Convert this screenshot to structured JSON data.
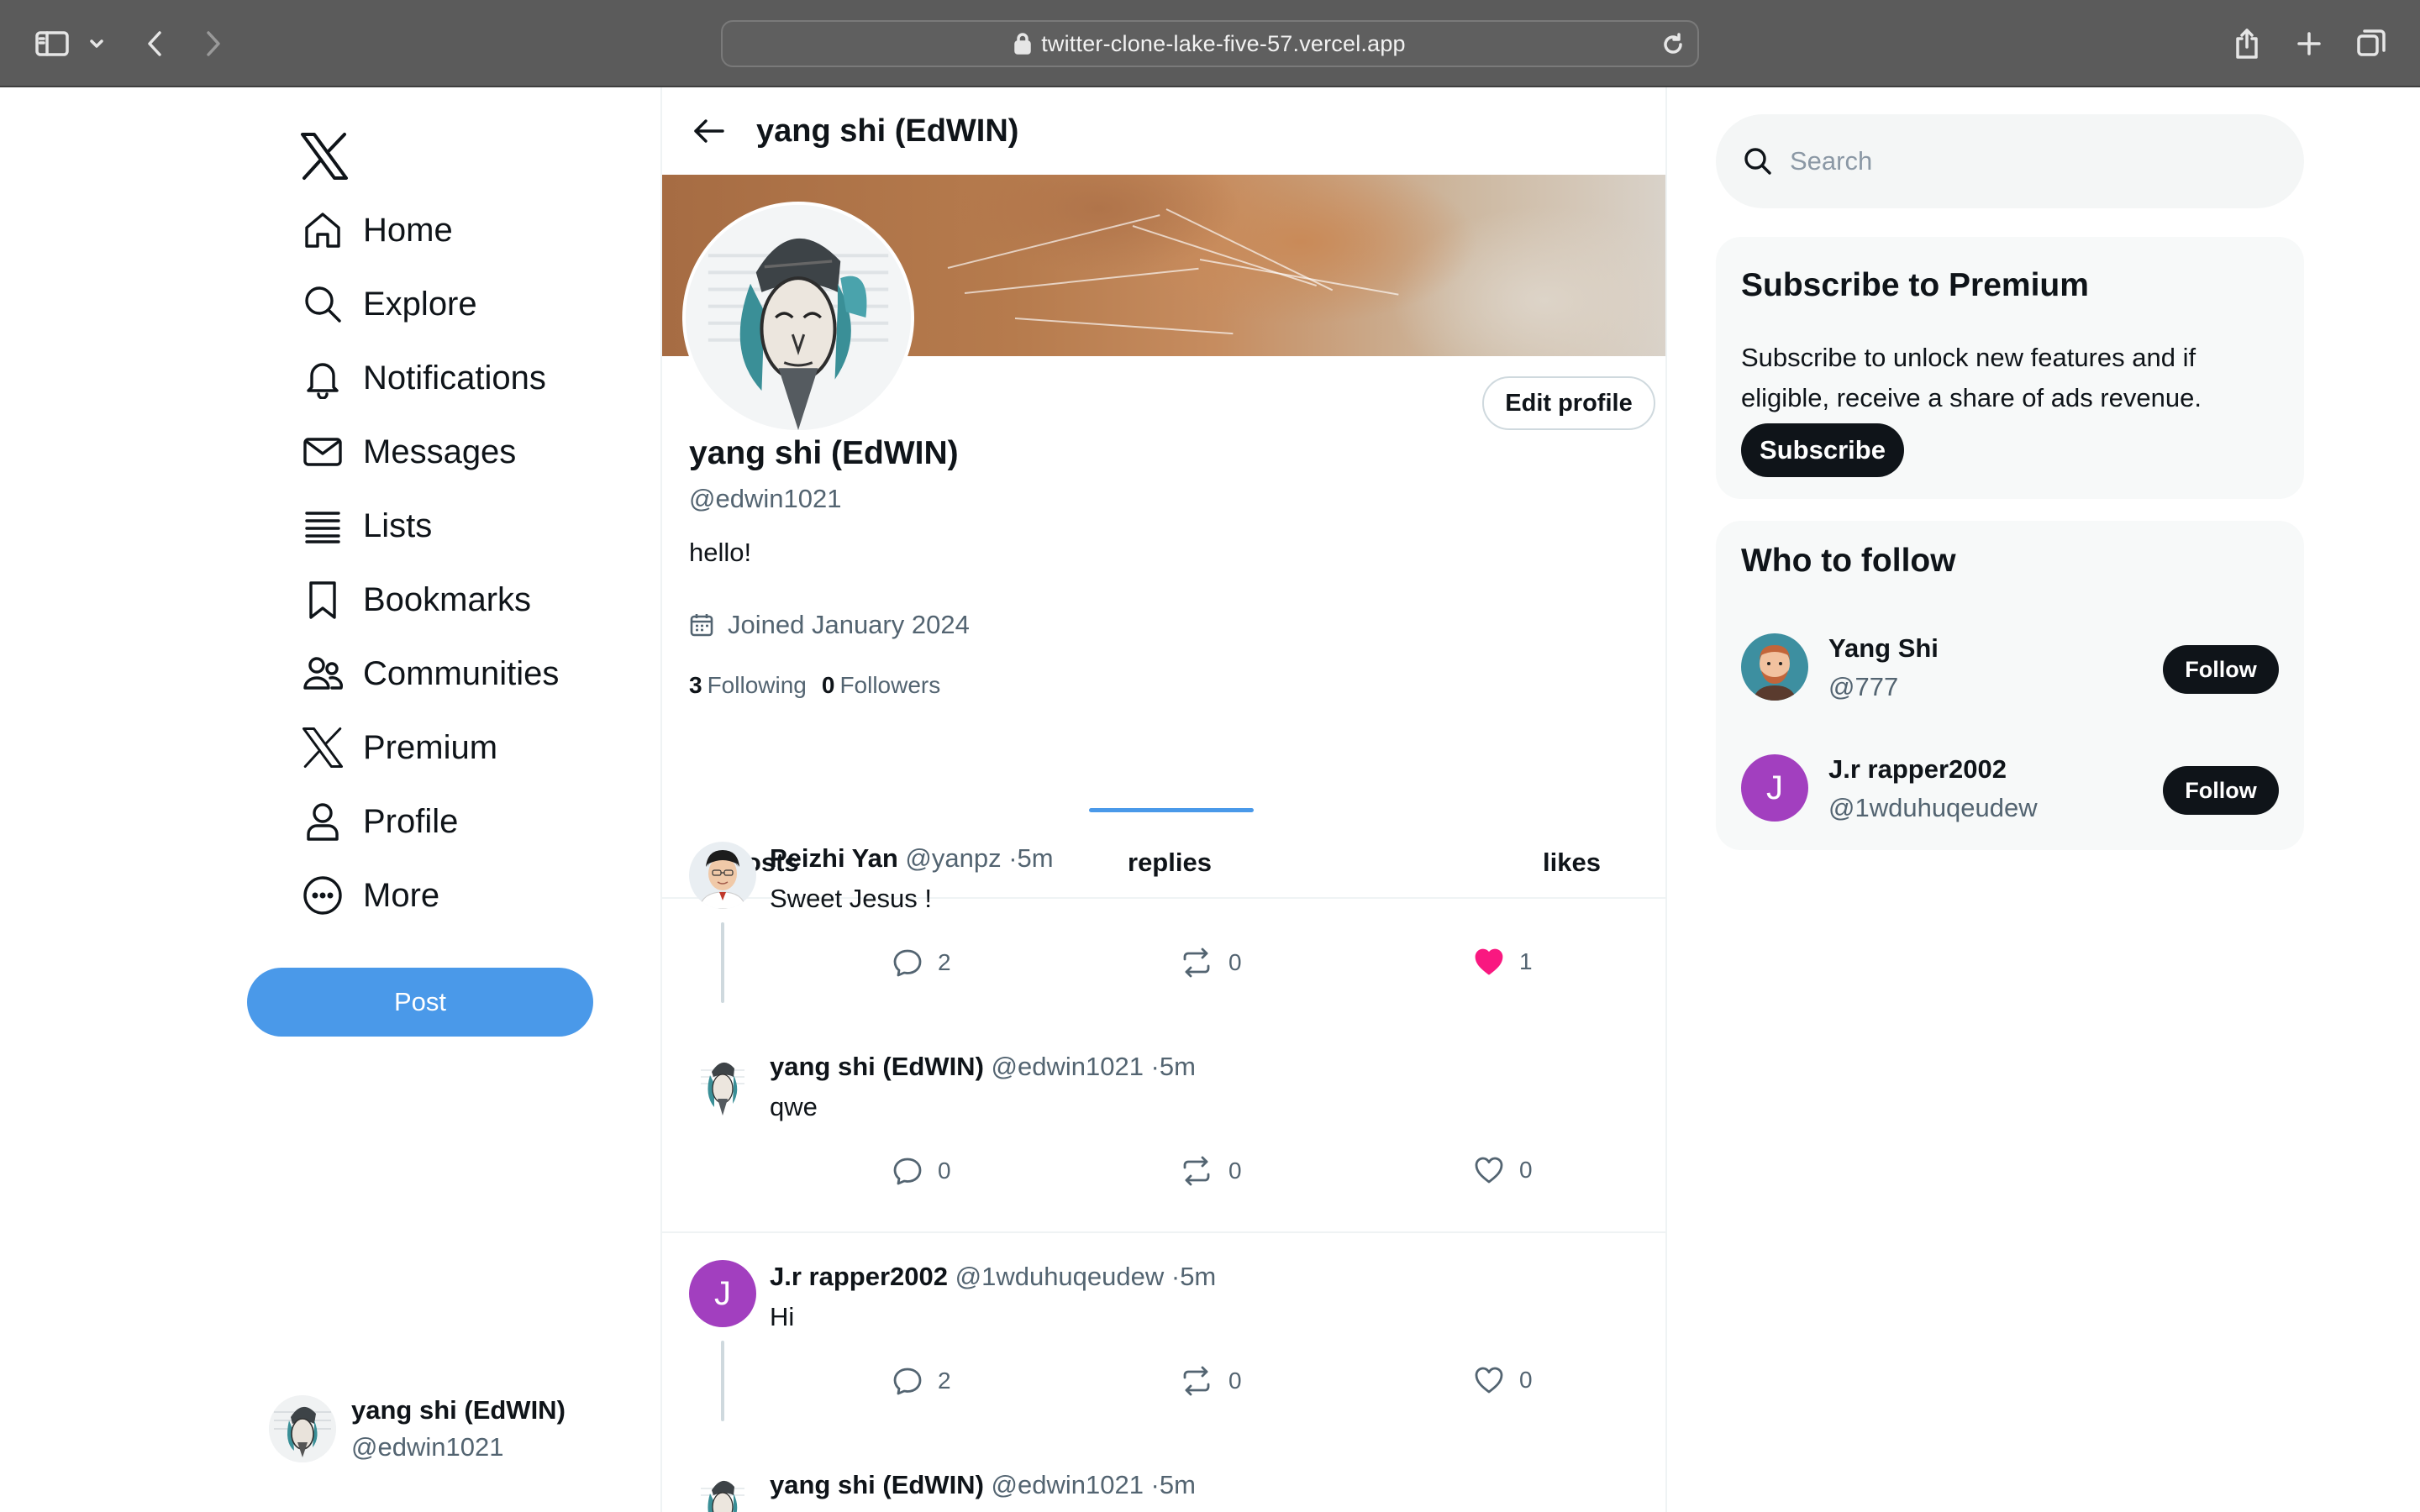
{
  "browser": {
    "url": "twitter-clone-lake-five-57.vercel.app"
  },
  "sidebar": {
    "items": [
      {
        "label": "Home",
        "icon": "home-icon"
      },
      {
        "label": "Explore",
        "icon": "search-icon"
      },
      {
        "label": "Notifications",
        "icon": "bell-icon"
      },
      {
        "label": "Messages",
        "icon": "mail-icon"
      },
      {
        "label": "Lists",
        "icon": "list-icon"
      },
      {
        "label": "Bookmarks",
        "icon": "bookmark-icon"
      },
      {
        "label": "Communities",
        "icon": "people-icon"
      },
      {
        "label": "Premium",
        "icon": "x-logo-icon"
      },
      {
        "label": "Profile",
        "icon": "user-icon"
      },
      {
        "label": "More",
        "icon": "more-circle-icon"
      }
    ],
    "post_label": "Post",
    "account": {
      "name": "yang shi (EdWIN)",
      "handle": "@edwin1021"
    }
  },
  "profile": {
    "header_title": "yang shi (EdWIN)",
    "name": "yang shi (EdWIN)",
    "handle": "@edwin1021",
    "bio": "hello!",
    "joined": "Joined January 2024",
    "following_count": "3",
    "following_label": "Following",
    "followers_count": "0",
    "followers_label": "Followers",
    "edit_label": "Edit profile",
    "tabs": [
      {
        "label": "posts",
        "active": false
      },
      {
        "label": "replies",
        "active": true
      },
      {
        "label": "likes",
        "active": false
      }
    ]
  },
  "replies": [
    {
      "name": "Peizhi Yan",
      "meta": "@yanpz ·5m",
      "text": "Sweet Jesus !",
      "comments": "2",
      "retweets": "0",
      "likes": "1",
      "liked": true
    },
    {
      "name": "yang shi (EdWIN)",
      "meta": "@edwin1021 ·5m",
      "text": "qwe",
      "comments": "0",
      "retweets": "0",
      "likes": "0",
      "liked": false
    },
    {
      "name": "J.r rapper2002",
      "meta": "@1wduhuqeudew ·5m",
      "text": "Hi",
      "comments": "2",
      "retweets": "0",
      "likes": "0",
      "liked": false,
      "initial": "J"
    },
    {
      "name": "yang shi (EdWIN)",
      "meta": "@edwin1021 ·5m"
    }
  ],
  "right": {
    "search_placeholder": "Search",
    "premium": {
      "title": "Subscribe to Premium",
      "text": "Subscribe to unlock new features and if eligible, receive a share of ads revenue.",
      "button": "Subscribe"
    },
    "who_to_follow": {
      "title": "Who to follow",
      "users": [
        {
          "name": "Yang Shi",
          "handle": "@777",
          "button": "Follow"
        },
        {
          "name": "J.r rapper2002",
          "handle": "@1wduhuqeudew",
          "button": "Follow",
          "initial": "J"
        }
      ]
    }
  },
  "colors": {
    "accent": "#4a99e9",
    "like": "#f91880",
    "letter_avatar": "#a23fbf"
  }
}
